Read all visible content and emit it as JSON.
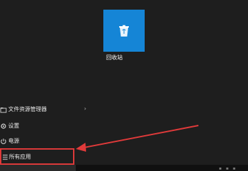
{
  "tile": {
    "label": "回收站",
    "icon": "recycle-bin-icon",
    "color": "#1585d6"
  },
  "menu": {
    "items": [
      {
        "label": "文件资源管理器",
        "icon": "folder-icon",
        "has_submenu": true
      },
      {
        "label": "设置",
        "icon": "gear-icon"
      },
      {
        "label": "电源",
        "icon": "power-icon"
      },
      {
        "label": "所有应用",
        "icon": "list-icon"
      }
    ]
  },
  "annotation": {
    "color": "#e03a3a",
    "target": "所有应用"
  }
}
